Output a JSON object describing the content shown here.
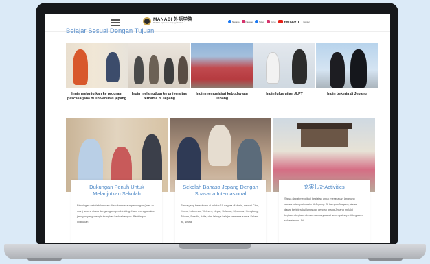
{
  "header": {
    "logo_name": "MANABI 外語学院",
    "logo_sub": "MANABI Japanese Language Institute",
    "social": [
      {
        "icon": "facebook-icon",
        "label": "Nagano"
      },
      {
        "icon": "instagram-icon",
        "label": "Nagano"
      },
      {
        "icon": "facebook-icon",
        "label": "Tokyo"
      },
      {
        "icon": "instagram-icon",
        "label": "Tokyo"
      }
    ],
    "youtube_label": "YouTube",
    "contact_label": "Contact"
  },
  "section_title": "Belajar Sesuai Dengan Tujuan",
  "purpose_cards": [
    {
      "caption": "Ingin melanjutkan ke program pascasarjana di universitas jepang"
    },
    {
      "caption": "Ingin melanjutkan ke universitas ternama di Jepang"
    },
    {
      "caption": "Ingin mempelajari kebudayaan Jepang"
    },
    {
      "caption": "Ingin lulus ujian JLPT"
    },
    {
      "caption": "Ingin bekerja di Jepang"
    }
  ],
  "feature_cards": [
    {
      "title": "Dukungan Penuh Untuk Melanjutkan Sekolah",
      "body": "Bimbingan sekolah lanjutan dilakukan secara pemengan (man-to-man) antara siswa dengan guru pembimbing. Kami menggunakan jaringan yang menghubungkan kedua kampus. Bimbingan dilakukan"
    },
    {
      "title": "Sekolah Bahasa Jepang Dengan Suasana Internasional",
      "body": "Siswa yang bersekolah di sekitar 10 negara di dunia, seperti Cina, Korea, Indonesia, Vietnam, Nepal, Srilanka, Myanmar, Hongkong, Taiwan, Swedia, Italia, dan lainnya belajar bersama-sama. Selain itu, siswa"
    },
    {
      "title": "充実したActivities",
      "body": "Siswa dapat mengikuti kegiatan untuk merasakan langsung suasana tempat musim di Jepang. Di kampus Nagano, siswa dapat berinteraksi langsung dengan orang Jepang melalui kegiatan-kegiatan bersama masyarakat setempat seperti kegiatan sukarelawan. Di"
    }
  ]
}
